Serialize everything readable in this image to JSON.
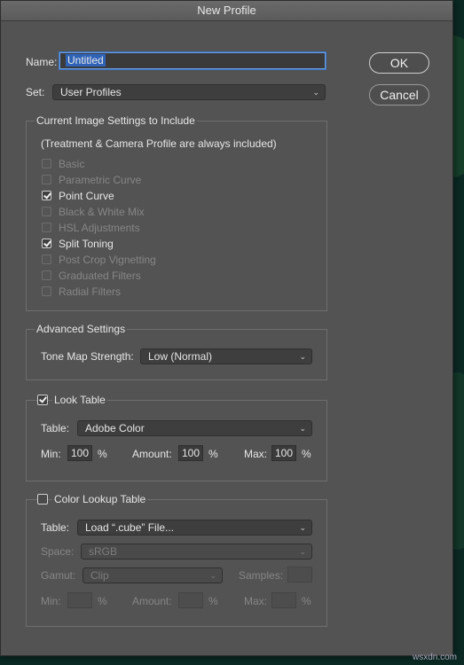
{
  "window": {
    "title": "New Profile"
  },
  "name": {
    "label": "Name:",
    "value": "Untitled"
  },
  "set": {
    "label": "Set:",
    "value": "User Profiles"
  },
  "buttons": {
    "ok": "OK",
    "cancel": "Cancel"
  },
  "image_settings": {
    "title": "Current Image Settings to Include",
    "note": "(Treatment & Camera Profile are always included)",
    "items": [
      {
        "label": "Basic",
        "checked": false,
        "enabled": false
      },
      {
        "label": "Parametric Curve",
        "checked": false,
        "enabled": false
      },
      {
        "label": "Point Curve",
        "checked": true,
        "enabled": true
      },
      {
        "label": "Black & White Mix",
        "checked": false,
        "enabled": false
      },
      {
        "label": "HSL Adjustments",
        "checked": false,
        "enabled": false
      },
      {
        "label": "Split Toning",
        "checked": true,
        "enabled": true
      },
      {
        "label": "Post Crop Vignetting",
        "checked": false,
        "enabled": false
      },
      {
        "label": "Graduated Filters",
        "checked": false,
        "enabled": false
      },
      {
        "label": "Radial Filters",
        "checked": false,
        "enabled": false
      }
    ]
  },
  "advanced": {
    "title": "Advanced Settings",
    "tone_map_label": "Tone Map Strength:",
    "tone_map_value": "Low (Normal)"
  },
  "look_table": {
    "title": "Look Table",
    "checked": true,
    "table_label": "Table:",
    "table_value": "Adobe Color",
    "min_label": "Min:",
    "min_value": "100",
    "amount_label": "Amount:",
    "amount_value": "100",
    "max_label": "Max:",
    "max_value": "100",
    "percent": "%"
  },
  "color_lookup": {
    "title": "Color Lookup Table",
    "checked": false,
    "table_label": "Table:",
    "table_value": "Load “.cube” File...",
    "space_label": "Space:",
    "space_value": "sRGB",
    "gamut_label": "Gamut:",
    "gamut_value": "Clip",
    "samples_label": "Samples:",
    "min_label": "Min:",
    "amount_label": "Amount:",
    "max_label": "Max:",
    "percent": "%"
  },
  "watermark": "wsxdn.com"
}
